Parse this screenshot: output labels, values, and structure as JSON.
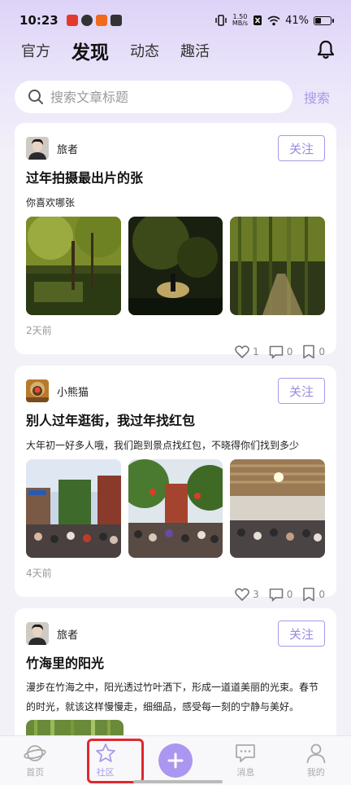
{
  "status_bar": {
    "time": "10:23",
    "net_speed_value": "1.50",
    "net_speed_unit": "MB/s",
    "battery_percent": "41%",
    "battery_level": 0.41
  },
  "tabs": [
    {
      "label": "官方",
      "active": false
    },
    {
      "label": "发现",
      "active": true
    },
    {
      "label": "动态",
      "active": false
    },
    {
      "label": "趣活",
      "active": false
    }
  ],
  "search": {
    "placeholder": "搜索文章标题",
    "button_label": "搜索"
  },
  "posts": [
    {
      "username": "旅者",
      "follow_label": "关注",
      "title": "过年拍摄最出片的张",
      "desc": "你喜欢哪张",
      "time": "2天前",
      "likes": "1",
      "comments": "0",
      "bookmarks": "0"
    },
    {
      "username": "小熊猫",
      "follow_label": "关注",
      "title": "别人过年逛街，我过年找红包",
      "desc": "大年初一好多人哦，我们跑到景点找红包，不晓得你们找到多少",
      "time": "4天前",
      "likes": "3",
      "comments": "0",
      "bookmarks": "0"
    },
    {
      "username": "旅者",
      "follow_label": "关注",
      "title": "竹海里的阳光",
      "desc": "漫步在竹海之中，阳光透过竹叶洒下，形成一道道美丽的光束。春节的时光，就该这样慢慢走，细细品，感受每一刻的宁静与美好。"
    }
  ],
  "bottom_nav": [
    {
      "label": "首页",
      "icon": "planet-icon"
    },
    {
      "label": "社区",
      "icon": "star-icon",
      "active": true
    },
    {
      "label": "",
      "icon": "plus-icon"
    },
    {
      "label": "消息",
      "icon": "chat-icon"
    },
    {
      "label": "我的",
      "icon": "user-icon"
    }
  ],
  "colors": {
    "accent": "#a89ae6",
    "highlight": "#e0282d"
  }
}
